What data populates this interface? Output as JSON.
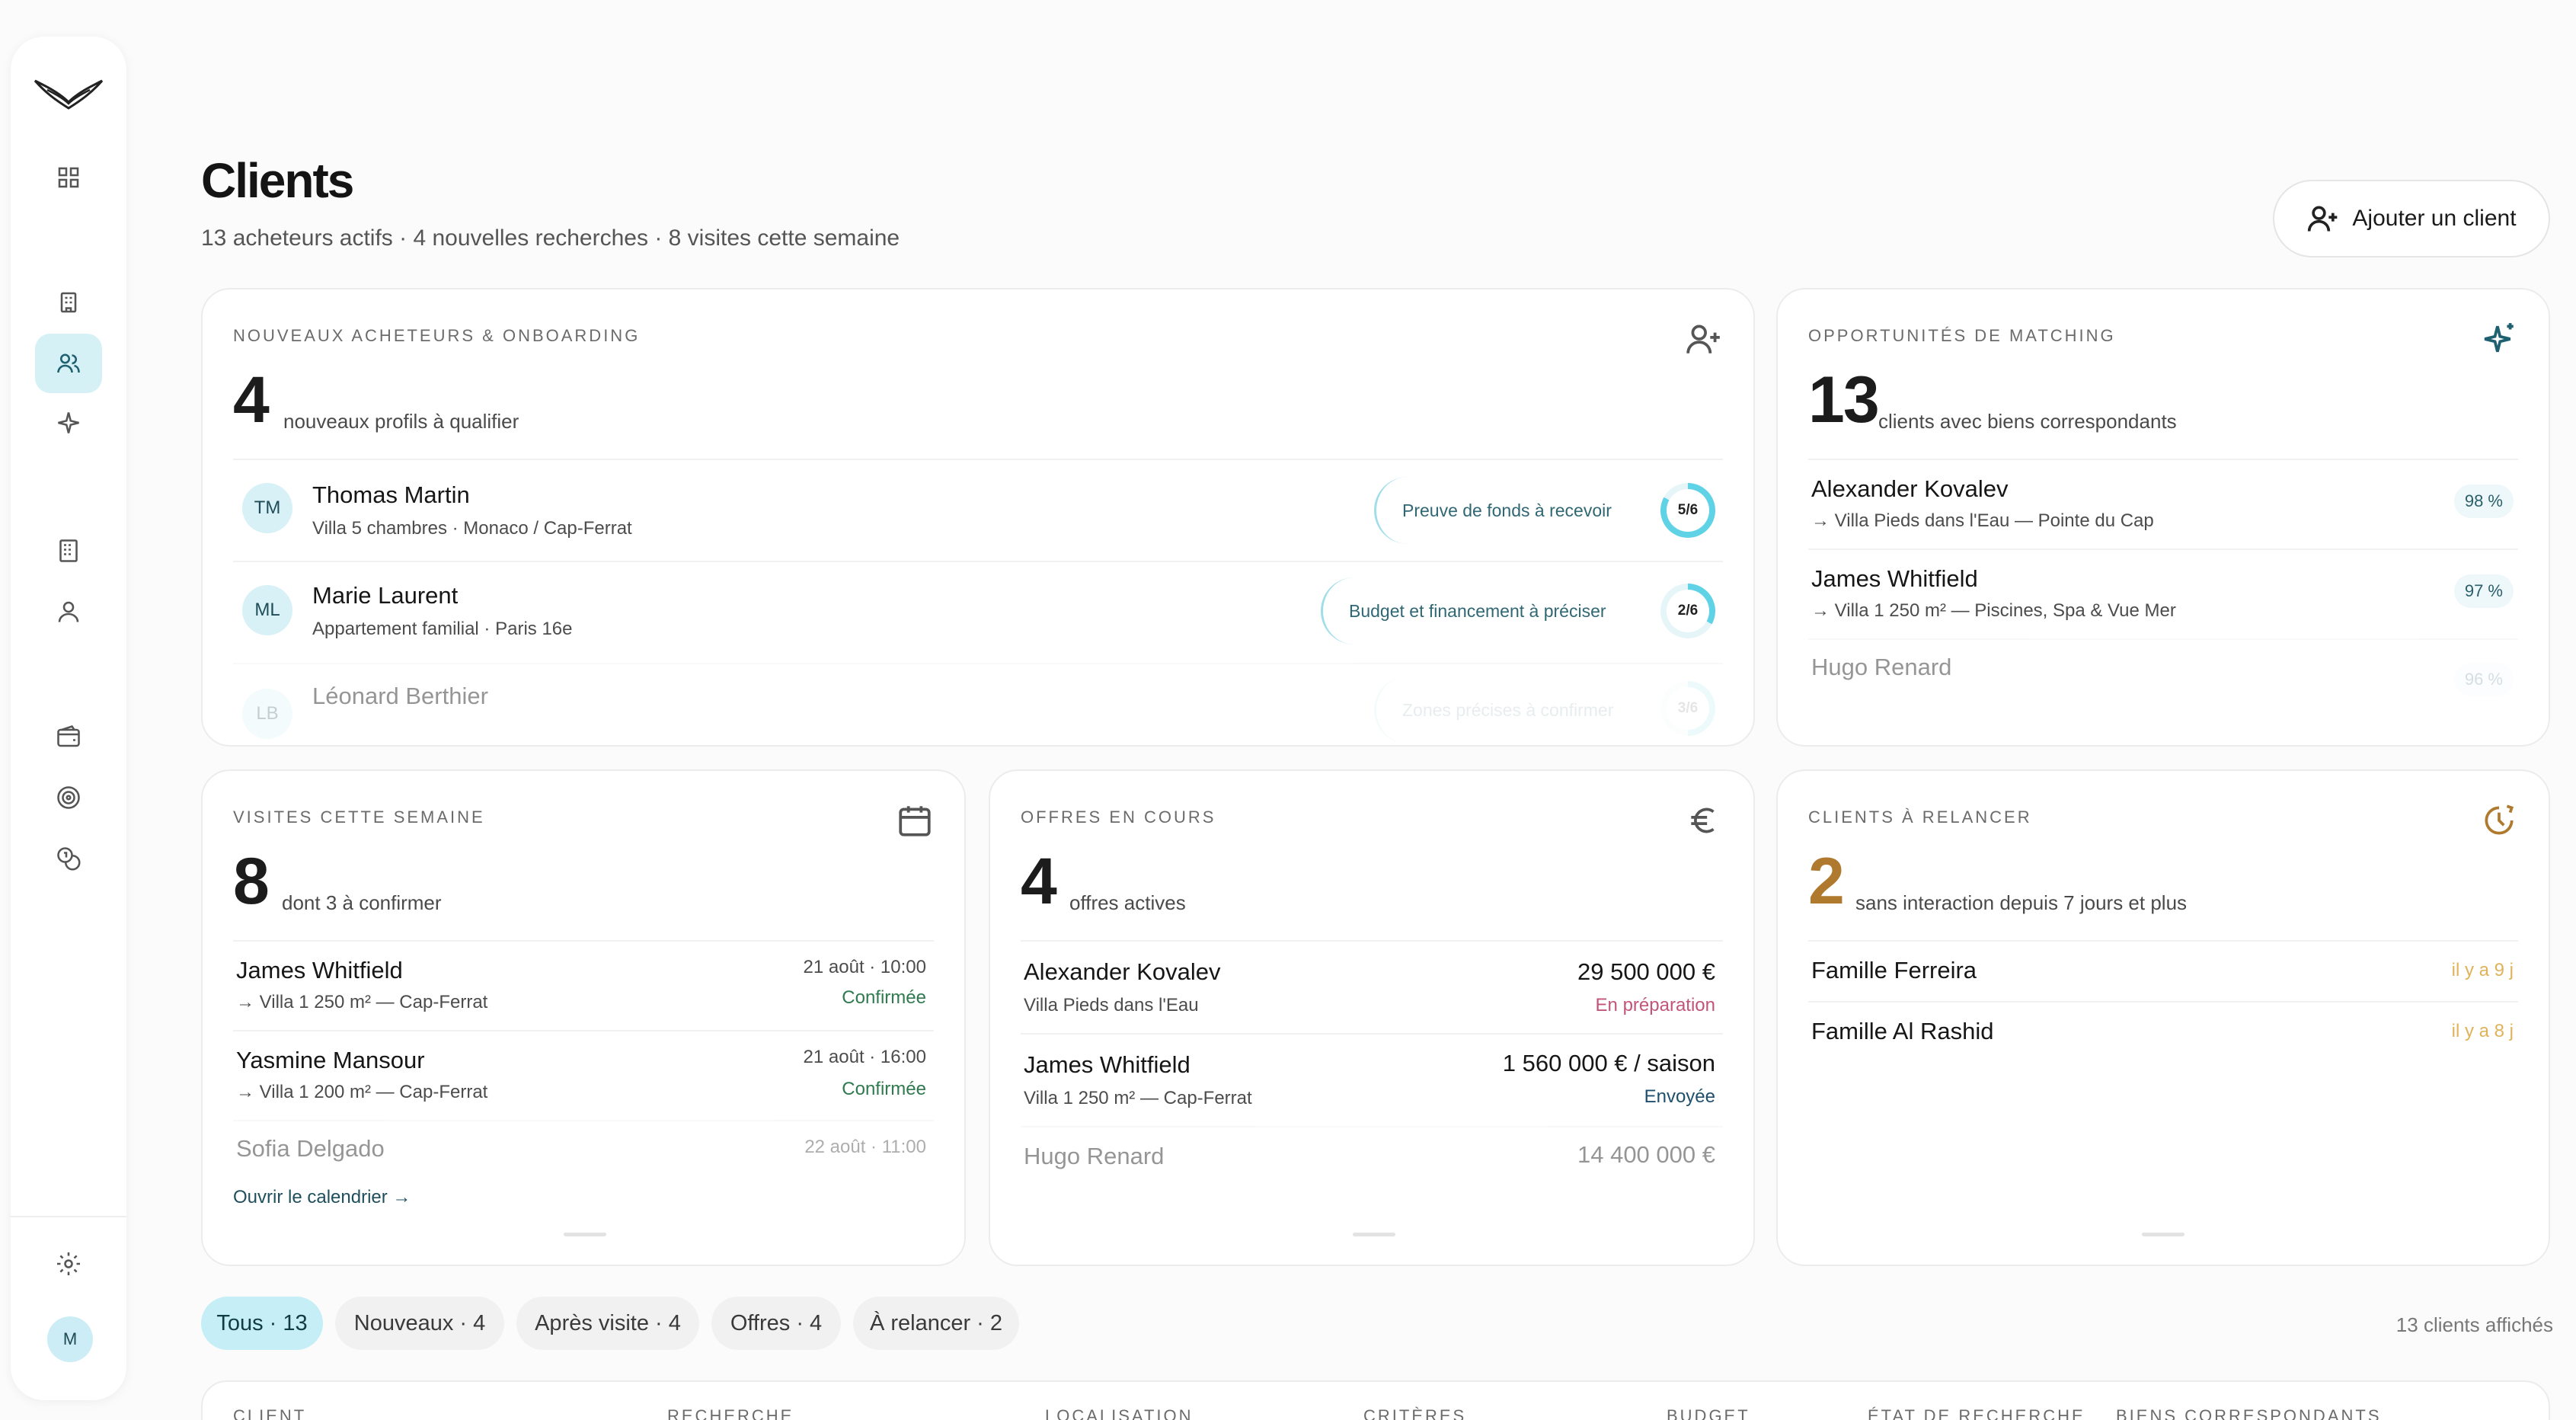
{
  "sidebar": {
    "items": [
      {
        "name": "dashboard",
        "icon": "dashboard-grid-icon"
      },
      {
        "name": "properties",
        "icon": "building-icon"
      },
      {
        "name": "clients",
        "icon": "users-icon",
        "active": true
      },
      {
        "name": "matching",
        "icon": "sparkle-icon"
      },
      {
        "name": "agencies",
        "icon": "office-icon"
      },
      {
        "name": "contacts",
        "icon": "user-icon"
      },
      {
        "name": "wallet",
        "icon": "wallet-icon"
      },
      {
        "name": "goals",
        "icon": "target-icon"
      },
      {
        "name": "commissions",
        "icon": "coins-icon"
      },
      {
        "name": "settings",
        "icon": "gear-icon"
      }
    ],
    "avatar": "M"
  },
  "header": {
    "title": "Clients",
    "subtitle": "13 acheteurs actifs · 4 nouvelles recherches · 8 visites cette semaine",
    "add_button": "Ajouter un client"
  },
  "onboarding": {
    "label": "NOUVEAUX ACHETEURS & ONBOARDING",
    "count": "4",
    "caption": "nouveaux profils à qualifier",
    "rows": [
      {
        "initials": "TM",
        "name": "Thomas Martin",
        "sub": "Villa 5 chambres · Monaco / Cap-Ferrat",
        "tag": "Preuve de fonds à recevoir",
        "progress": "5/6",
        "fraction": 0.833
      },
      {
        "initials": "ML",
        "name": "Marie Laurent",
        "sub": "Appartement familial · Paris 16e",
        "tag": "Budget et financement à préciser",
        "progress": "2/6",
        "fraction": 0.333
      },
      {
        "initials": "LB",
        "name": "Léonard Berthier",
        "sub": "",
        "tag": "Zones précises à confirmer",
        "progress": "3/6",
        "fraction": 0.5
      }
    ]
  },
  "matching": {
    "label": "OPPORTUNITÉS DE MATCHING",
    "count": "13",
    "caption": "clients avec biens correspondants",
    "rows": [
      {
        "name": "Alexander Kovalev",
        "sub": "→ Villa Pieds dans l'Eau — Pointe du Cap",
        "pct": "98 %"
      },
      {
        "name": "James Whitfield",
        "sub": "→ Villa 1 250 m² — Piscines, Spa & Vue Mer",
        "pct": "97 %"
      },
      {
        "name": "Hugo Renard",
        "sub": "",
        "pct": "96 %"
      }
    ]
  },
  "visits": {
    "label": "VISITES CETTE SEMAINE",
    "count": "8",
    "caption": "dont 3 à confirmer",
    "rows": [
      {
        "name": "James Whitfield",
        "sub": "→ Villa 1 250 m² — Cap-Ferrat",
        "date": "21 août · 10:00",
        "status": "Confirmée"
      },
      {
        "name": "Yasmine Mansour",
        "sub": "→ Villa 1 200 m² — Cap-Ferrat",
        "date": "21 août · 16:00",
        "status": "Confirmée"
      },
      {
        "name": "Sofia Delgado",
        "sub": "",
        "date": "22 août · 11:00",
        "status": ""
      }
    ],
    "link": "Ouvrir le calendrier →"
  },
  "offers": {
    "label": "OFFRES EN COURS",
    "count": "4",
    "caption": "offres actives",
    "rows": [
      {
        "name": "Alexander Kovalev",
        "sub": "Villa Pieds dans l'Eau",
        "amount": "29 500 000 €",
        "status": "En préparation"
      },
      {
        "name": "James Whitfield",
        "sub": "Villa 1 250 m² — Cap-Ferrat",
        "amount": "1 560 000 € / saison",
        "status": "Envoyée"
      },
      {
        "name": "Hugo Renard",
        "sub": "",
        "amount": "14 400 000 €",
        "status": ""
      }
    ]
  },
  "followup": {
    "label": "CLIENTS À RELANCER",
    "count": "2",
    "caption": "sans interaction depuis 7 jours et plus",
    "rows": [
      {
        "name": "Famille Ferreira",
        "ago": "il y a 9 j"
      },
      {
        "name": "Famille Al Rashid",
        "ago": "il y a 8 j"
      }
    ]
  },
  "filters": {
    "chips": [
      "Tous · 13",
      "Nouveaux · 4",
      "Après visite · 4",
      "Offres · 4",
      "À relancer · 2"
    ],
    "shown": "13 clients affichés"
  },
  "table": {
    "headers": [
      "CLIENT",
      "RECHERCHE",
      "LOCALISATION",
      "CRITÈRES",
      "BUDGET",
      "ÉTAT DE RECHERCHE",
      "BIENS CORRESPONDANTS"
    ]
  },
  "colors": {
    "accent": "#c6eef6",
    "accent_dark": "#1e6070",
    "confirm": "#2f7a4e",
    "preparing": "#c2547a",
    "sent": "#1f4f6c",
    "followup": "#b07a2e",
    "ago": "#e0b25a"
  }
}
